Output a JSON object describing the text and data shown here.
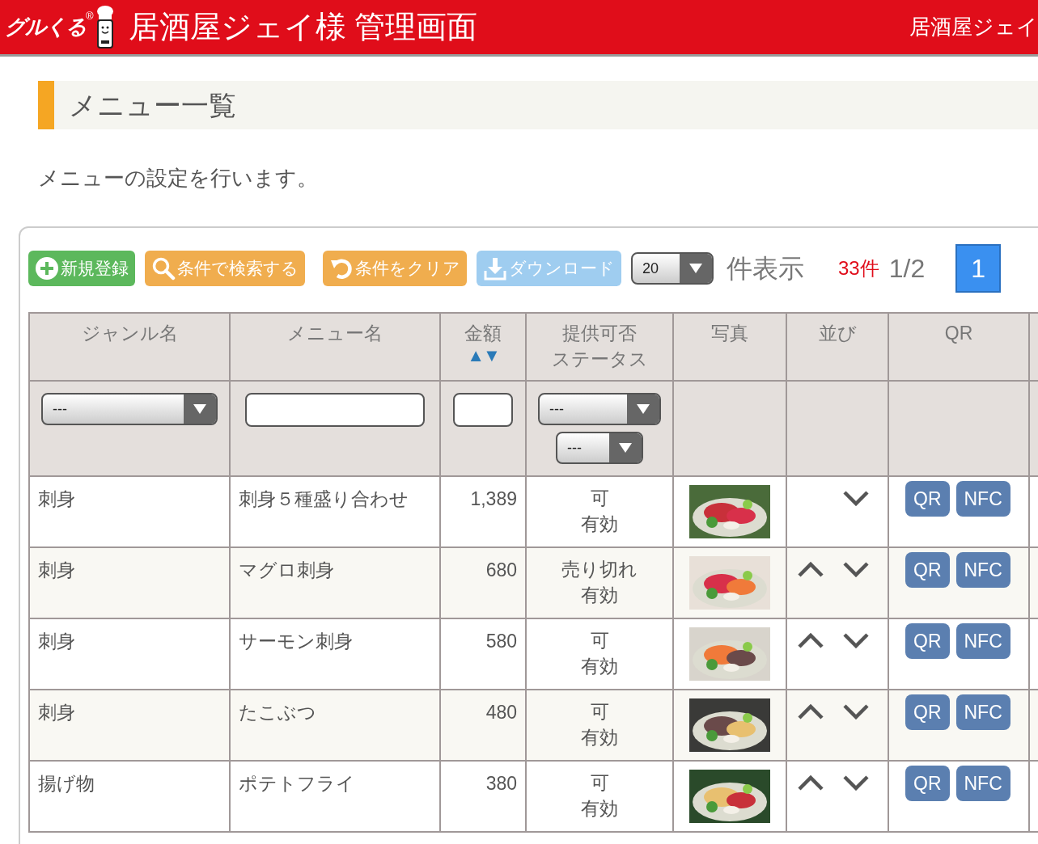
{
  "header": {
    "logo_text": "グルくる",
    "logo_mark": "®",
    "title": "居酒屋ジェイ様 管理画面",
    "right_text": "居酒屋ジェイ"
  },
  "page_title": "メニュー一覧",
  "description": "メニューの設定を行います。",
  "toolbar": {
    "buttons": [
      {
        "kind": "add",
        "label": "新規登録"
      },
      {
        "kind": "search",
        "label": "条件で検索する"
      },
      {
        "kind": "clear",
        "label": "条件をクリア"
      },
      {
        "kind": "download",
        "label": "ダウンロード"
      }
    ],
    "page_size": "20",
    "page_size_label": "件表示",
    "count": "33件",
    "page_info": "1/2",
    "pages": [
      {
        "label": "1",
        "selected": true
      }
    ]
  },
  "table": {
    "columns": [
      {
        "label": [
          "ジャンル名"
        ]
      },
      {
        "label": [
          "メニュー名"
        ]
      },
      {
        "label": [
          "金額"
        ],
        "sort": "▲▼"
      },
      {
        "label": [
          "提供可否",
          "ステータス"
        ]
      },
      {
        "label": [
          "写真"
        ]
      },
      {
        "label": [
          "並び"
        ]
      },
      {
        "label": [
          "QR"
        ]
      }
    ],
    "filters": {
      "genre": "---",
      "availability": "---",
      "status": "---"
    },
    "rows": [
      {
        "genre": "刺身",
        "name": "刺身５種盛り合わせ",
        "price": "1,389",
        "availability": "可",
        "status": "有効",
        "can_move_up": false,
        "can_move_down": true,
        "qr": "QR",
        "nfc": "NFC"
      },
      {
        "genre": "刺身",
        "name": "マグロ刺身",
        "price": "680",
        "availability": "売り切れ",
        "status": "有効",
        "can_move_up": true,
        "can_move_down": true,
        "qr": "QR",
        "nfc": "NFC"
      },
      {
        "genre": "刺身",
        "name": "サーモン刺身",
        "price": "580",
        "availability": "可",
        "status": "有効",
        "can_move_up": true,
        "can_move_down": true,
        "qr": "QR",
        "nfc": "NFC"
      },
      {
        "genre": "刺身",
        "name": "たこぶつ",
        "price": "480",
        "availability": "可",
        "status": "有効",
        "can_move_up": true,
        "can_move_down": true,
        "qr": "QR",
        "nfc": "NFC"
      },
      {
        "genre": "揚げ物",
        "name": "ポテトフライ",
        "price": "380",
        "availability": "可",
        "status": "有効",
        "can_move_up": true,
        "can_move_down": true,
        "qr": "QR",
        "nfc": "NFC"
      }
    ]
  }
}
